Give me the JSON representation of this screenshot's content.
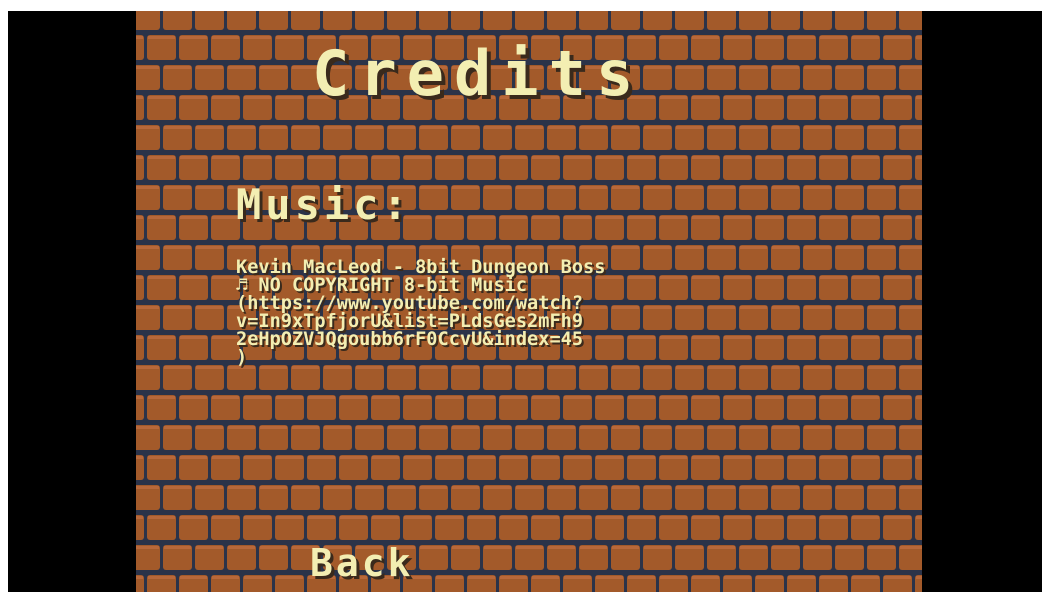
{
  "screen": {
    "title": "Credits",
    "section_heading": "Music:",
    "credit_lines": [
      "Kevin MacLeod - 8bit Dungeon Boss",
      "♬ NO COPYRIGHT 8-bit Music",
      "(https://www.youtube.com/watch?",
      "v=In9xTpfjorU&list=PLdsGes2mFh9",
      "2eHpOZVJQgoubb6rF0CcvU&index=45",
      ")"
    ],
    "back_label": "Back"
  },
  "colors": {
    "text": "#f3eeb2",
    "brick": "#a35a2a",
    "mortar": "#2b3349",
    "letterbox": "#000000"
  }
}
